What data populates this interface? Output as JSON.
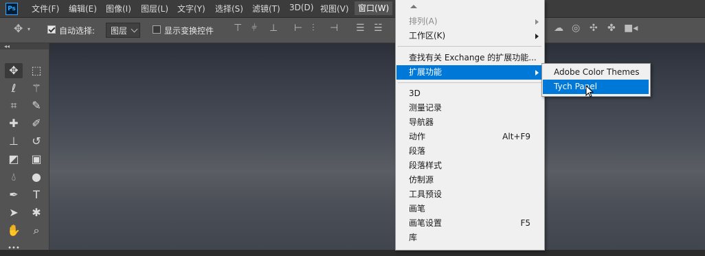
{
  "app": {
    "logo": "Ps"
  },
  "menubar": {
    "items": [
      "文件(F)",
      "编辑(E)",
      "图像(I)",
      "图层(L)",
      "文字(Y)",
      "选择(S)",
      "滤镜(T)",
      "3D(D)",
      "视图(V)",
      "窗口(W)"
    ],
    "active": "窗口(W)"
  },
  "options": {
    "auto_select_label": "自动选择:",
    "auto_select_checked": true,
    "layer_select_value": "图层",
    "show_transform_label": "显示变换控件",
    "show_transform_checked": false
  },
  "toolbox": {
    "tools": [
      "move-tool",
      "marquee-tool",
      "lasso-tool",
      "magic-wand-tool",
      "crop-tool",
      "eyedropper-tool",
      "healing-brush-tool",
      "brush-tool",
      "stamp-tool",
      "history-brush-tool",
      "eraser-tool",
      "gradient-tool",
      "blur-tool",
      "dodge-tool",
      "pen-tool",
      "type-tool",
      "path-selection-tool",
      "shape-tool",
      "hand-tool",
      "zoom-tool"
    ],
    "selected": "move-tool"
  },
  "window_menu": {
    "arrange": "排列(A)",
    "workspace": "工作区(K)",
    "find_extensions": "查找有关 Exchange 的扩展功能...",
    "extensions": "扩展功能",
    "items": [
      {
        "label": "3D",
        "shortcut": ""
      },
      {
        "label": "测量记录",
        "shortcut": ""
      },
      {
        "label": "导航器",
        "shortcut": ""
      },
      {
        "label": "动作",
        "shortcut": "Alt+F9"
      },
      {
        "label": "段落",
        "shortcut": ""
      },
      {
        "label": "段落样式",
        "shortcut": ""
      },
      {
        "label": "仿制源",
        "shortcut": ""
      },
      {
        "label": "工具预设",
        "shortcut": ""
      },
      {
        "label": "画笔",
        "shortcut": ""
      },
      {
        "label": "画笔设置",
        "shortcut": "F5"
      },
      {
        "label": "库",
        "shortcut": ""
      }
    ]
  },
  "extensions_submenu": {
    "items": [
      "Adobe Color Themes",
      "Tych Panel"
    ],
    "highlighted": "Tych Panel"
  },
  "colors": {
    "highlight": "#0078d7",
    "menu_bg": "#f0f0f0",
    "ui_dark": "#535353"
  }
}
